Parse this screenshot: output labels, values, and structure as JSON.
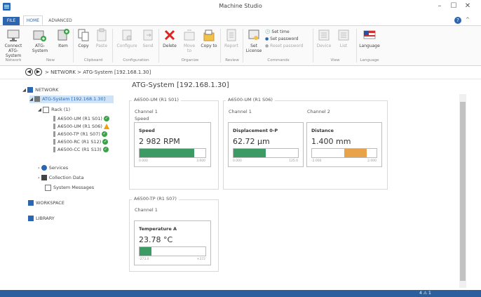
{
  "window": {
    "title": "Machine Studio",
    "minimize": "–",
    "maximize": "☐",
    "close": "✕"
  },
  "tabs": {
    "file": "FILE",
    "home": "HOME",
    "advanced": "ADVANCED"
  },
  "ribbon": {
    "connect": "Connect ATG-System",
    "atg_system": "ATG-System",
    "item": "Item",
    "copy": "Copy",
    "paste": "Paste",
    "configure": "Configure",
    "send": "Send",
    "delete": "Delete",
    "move_to": "Move to",
    "copy_to": "Copy to",
    "report": "Report",
    "set_license": "Set License",
    "set_time": "Set time",
    "set_password": "Set password",
    "reset_password": "Reset password",
    "device": "Device",
    "list": "List",
    "language": "Language",
    "groups": {
      "network": "Network",
      "new": "New",
      "clipboard": "Clipboard",
      "configuration": "Configuration",
      "organize": "Organize",
      "review": "Review",
      "commands": "Commands",
      "view": "View",
      "language": "Language"
    }
  },
  "address": {
    "back": "◀",
    "forward": "▶",
    "breadcrumb": "> NETWORK > ATG-System [192.168.1.30]"
  },
  "tree": {
    "network": "NETWORK",
    "atg_system": "ATG-System [192.168.1.30]",
    "rack": "Rack (1)",
    "modules": [
      {
        "label": "A6500-UM (R1 S01)",
        "status": "ok"
      },
      {
        "label": "A6500-UM (R1 S06)",
        "status": "warning"
      },
      {
        "label": "A6500-TP (R1 S07)",
        "status": "ok"
      },
      {
        "label": "A6500-RC (R1 S12)",
        "status": "ok"
      },
      {
        "label": "A6500-CC (R1 S13)",
        "status": "ok"
      }
    ],
    "services": "Services",
    "collection_data": "Collection Data",
    "system_messages": "System Messages",
    "workspace": "WORKSPACE",
    "library": "LIBRARY"
  },
  "content": {
    "title": "ATG-System [192.168.1.30]",
    "panels": {
      "s01": {
        "title": "A6500-UM (R1 S01)",
        "channel": "Channel 1",
        "sub": "Speed",
        "card": {
          "label": "Speed",
          "value": "2 982 RPM",
          "min": "0.000",
          "max": "3.600",
          "fill": 0.83,
          "color": "#3c9a64"
        }
      },
      "s06": {
        "title": "A6500-UM (R1 S06)",
        "channel1": "Channel 1",
        "channel2": "Channel 2",
        "card1": {
          "label": "Displacement 0-P",
          "value": "62.72 µm",
          "min": "0.000",
          "max": "125.0",
          "fill": 0.5,
          "color": "#3c9a64"
        },
        "card2": {
          "label": "Distance",
          "value": "1.400 mm",
          "min": "-2.000",
          "max": "2.000",
          "fill_from": 0.5,
          "fill_to": 0.85,
          "color": "#e8a24a"
        }
      },
      "s07": {
        "title": "A6500-TP (R1 S07)",
        "channel": "Channel 1",
        "card": {
          "label": "Temperature A",
          "value": "23.78 °C",
          "min": "-273.0",
          "max": "+372",
          "fill": 0.18,
          "color": "#3c9a64"
        }
      }
    }
  },
  "status": {
    "count": "4 ⚠ 1"
  }
}
